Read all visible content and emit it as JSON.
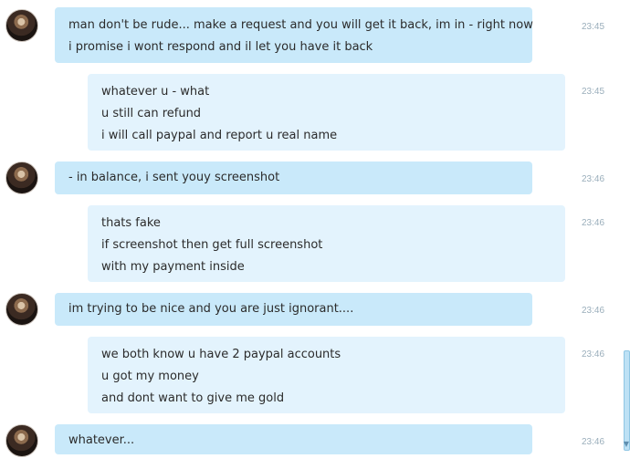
{
  "messages": [
    {
      "sender": "them",
      "lines": [
        "man don't be rude... make a request and you will get it back, im in - right now",
        "i promise i wont respond and il let you have it back"
      ],
      "time": "23:45"
    },
    {
      "sender": "me",
      "lines": [
        "whatever u - what",
        "u still can refund",
        "i will call paypal and report u real name"
      ],
      "time": "23:45"
    },
    {
      "sender": "them",
      "lines": [
        "- in balance, i sent youy screenshot"
      ],
      "time": "23:46"
    },
    {
      "sender": "me",
      "lines": [
        "thats fake",
        "if screenshot then get full screenshot",
        "with my payment inside"
      ],
      "time": "23:46"
    },
    {
      "sender": "them",
      "lines": [
        "im trying to be nice and you are just ignorant...."
      ],
      "time": "23:46"
    },
    {
      "sender": "me",
      "lines": [
        "we both know u have 2 paypal accounts",
        "u got my money",
        "and dont want to give me gold"
      ],
      "time": "23:46"
    },
    {
      "sender": "them",
      "lines": [
        "whatever..."
      ],
      "time": "23:46"
    }
  ],
  "colors": {
    "them_bubble": "#c9e9fa",
    "me_bubble": "#e3f3fd",
    "timestamp": "#9aaebb"
  },
  "icons": {
    "avatar": "avatar-icon",
    "scroll_down": "chevron-down-icon"
  }
}
